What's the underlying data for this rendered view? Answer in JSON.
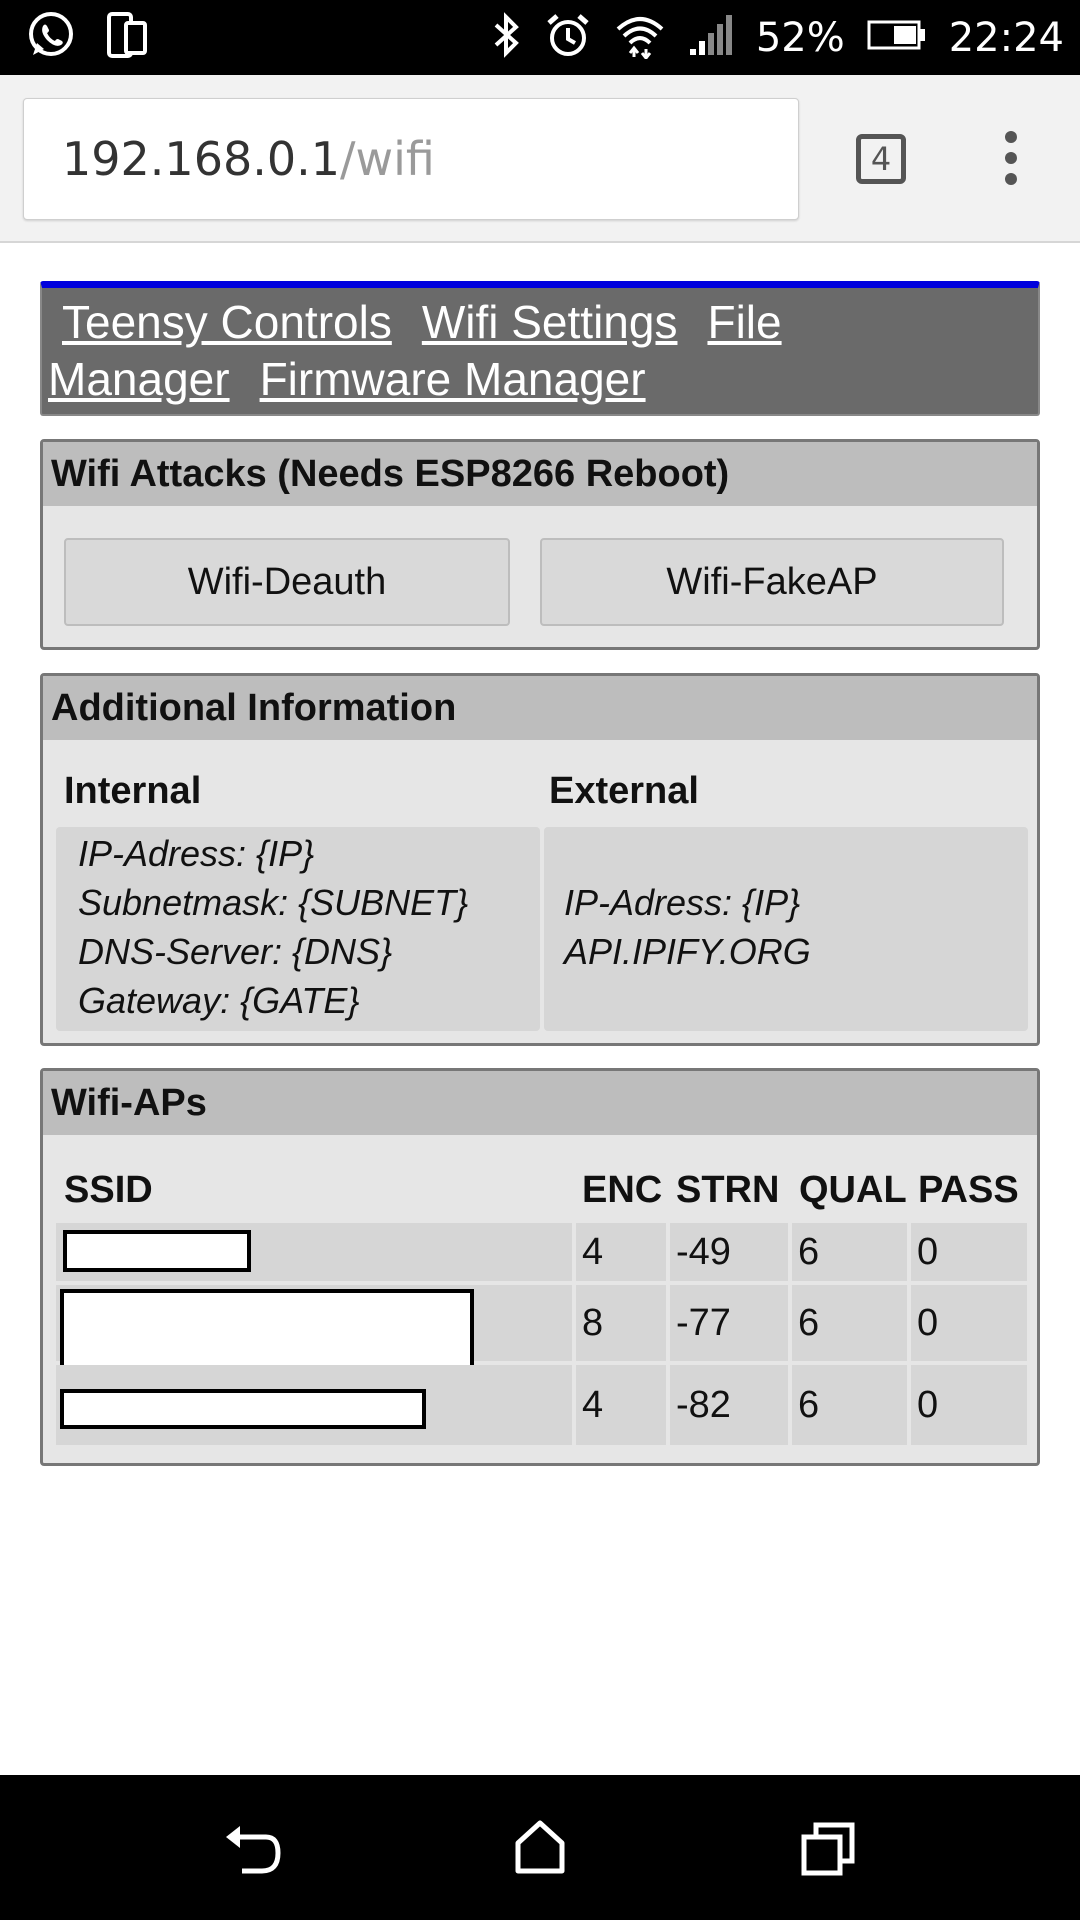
{
  "status_bar": {
    "battery": "52%",
    "time": "22:24"
  },
  "browser": {
    "url_host": "192.168.0.1",
    "url_path": "/wifi",
    "tab_count": "4"
  },
  "nav": {
    "links": [
      "Teensy Controls",
      "Wifi Settings",
      "File Manager",
      "Firmware Manager"
    ]
  },
  "attacks": {
    "title": "Wifi Attacks (Needs ESP8266 Reboot)",
    "buttons": [
      "Wifi-Deauth",
      "Wifi-FakeAP"
    ]
  },
  "info": {
    "title": "Additional Information",
    "internal_label": "Internal",
    "external_label": "External",
    "internal_lines": [
      "IP-Adress: {IP}",
      "Subnetmask: {SUBNET}",
      "DNS-Server: {DNS}",
      "Gateway: {GATE}"
    ],
    "external_lines": [
      "IP-Adress: {IP}",
      "API.IPIFY.ORG"
    ]
  },
  "aps": {
    "title": "Wifi-APs",
    "columns": [
      "SSID",
      "ENC",
      "STRN",
      "QUAL",
      "PASS"
    ],
    "rows": [
      {
        "enc": "4",
        "strn": "-49",
        "qual": "6",
        "pass": "0"
      },
      {
        "enc": "8",
        "strn": "-77",
        "qual": "6",
        "pass": "0"
      },
      {
        "enc": "4",
        "strn": "-82",
        "qual": "6",
        "pass": "0"
      }
    ]
  },
  "colors": {
    "nav_bg": "#6a6a6a",
    "nav_accent": "#0000dd",
    "panel_bg": "#e6e6e6",
    "panel_head": "#bdbdbd"
  }
}
